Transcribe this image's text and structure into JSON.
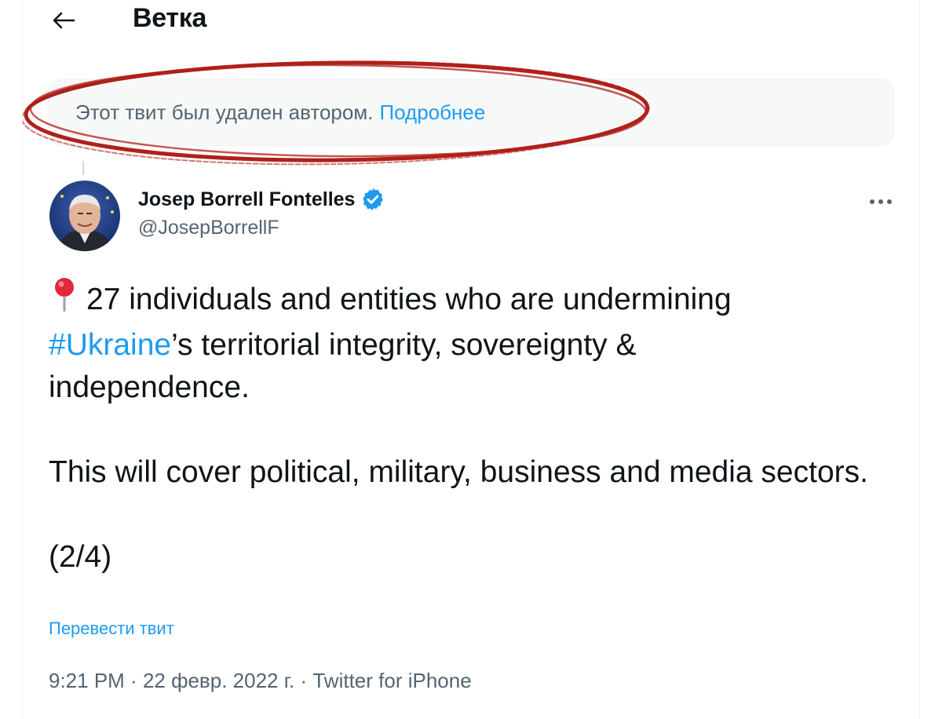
{
  "header": {
    "back_icon": "arrow-left-icon",
    "title": "Ветка"
  },
  "deleted_notice": {
    "text": "Этот твит был удален автором.",
    "link": "Подробнее",
    "annotation_color": "#b0201a"
  },
  "tweet": {
    "author_name": "Josep Borrell Fontelles",
    "handle": "@JosepBorrellF",
    "verified": true,
    "more_icon": "more-horizontal-icon",
    "text": {
      "pin_icon": "round-pushpin-icon",
      "line1": "27 individuals and entities who are undermining",
      "hashtag": "#Ukraine",
      "line2_rest": "’s territorial integrity, sovereignty &",
      "line3": "independence.",
      "para2": "This will cover political, military, business and media sectors.",
      "para3": "(2/4)"
    },
    "translate_link": "Перевести твит",
    "time": "9:21 PM",
    "date": "22 февр. 2022 г.",
    "source": "Twitter for iPhone",
    "separator": " · "
  },
  "colors": {
    "link": "#1d9bf0",
    "secondary_text": "#536471",
    "primary_text": "#0f1419"
  }
}
